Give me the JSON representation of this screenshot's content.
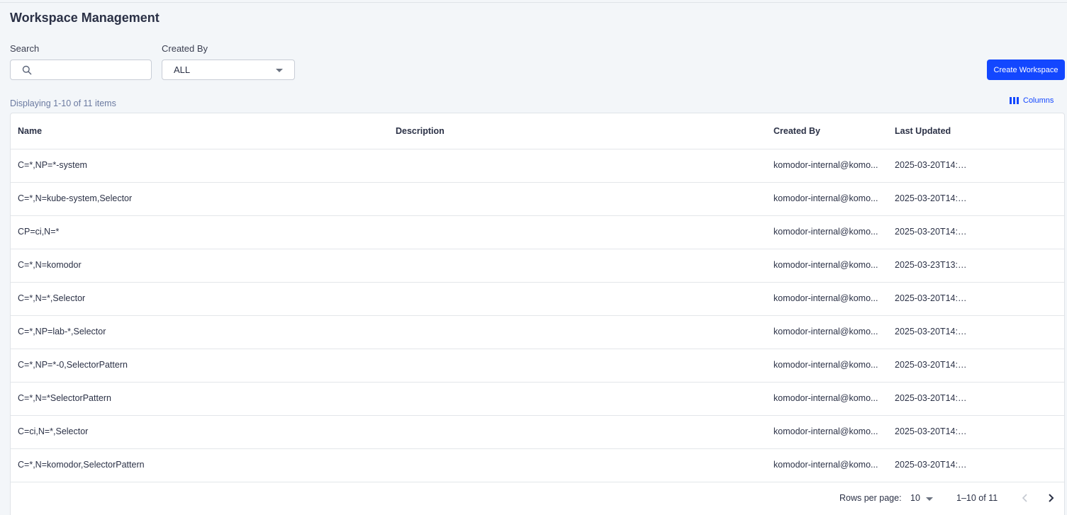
{
  "page": {
    "title": "Workspace Management"
  },
  "filters": {
    "search_label": "Search",
    "search_value": "",
    "created_by_label": "Created By",
    "created_by_value": "ALL"
  },
  "actions": {
    "create_label": "Create Workspace",
    "columns_label": "Columns"
  },
  "summary": {
    "displaying": "Displaying 1-10 of 11 items"
  },
  "table": {
    "headers": {
      "name": "Name",
      "description": "Description",
      "created_by": "Created By",
      "last_updated": "Last Updated"
    },
    "rows": [
      {
        "name": "C=*,NP=*-system",
        "description": "",
        "created_by": "komodor-internal@komo...",
        "last_updated": "2025-03-20T14:1..."
      },
      {
        "name": "C=*,N=kube-system,Selector",
        "description": "",
        "created_by": "komodor-internal@komo...",
        "last_updated": "2025-03-20T14:1..."
      },
      {
        "name": "CP=ci,N=*",
        "description": "",
        "created_by": "komodor-internal@komo...",
        "last_updated": "2025-03-20T14:1..."
      },
      {
        "name": "C=*,N=komodor",
        "description": "",
        "created_by": "komodor-internal@komo...",
        "last_updated": "2025-03-23T13:5..."
      },
      {
        "name": "C=*,N=*,Selector",
        "description": "",
        "created_by": "komodor-internal@komo...",
        "last_updated": "2025-03-20T14:1..."
      },
      {
        "name": "C=*,NP=lab-*,Selector",
        "description": "",
        "created_by": "komodor-internal@komo...",
        "last_updated": "2025-03-20T14:1..."
      },
      {
        "name": "C=*,NP=*-0,SelectorPattern",
        "description": "",
        "created_by": "komodor-internal@komo...",
        "last_updated": "2025-03-20T14:1..."
      },
      {
        "name": "C=*,N=*SelectorPattern",
        "description": "",
        "created_by": "komodor-internal@komo...",
        "last_updated": "2025-03-20T14:1..."
      },
      {
        "name": "C=ci,N=*,Selector",
        "description": "",
        "created_by": "komodor-internal@komo...",
        "last_updated": "2025-03-20T14:2..."
      },
      {
        "name": "C=*,N=komodor,SelectorPattern",
        "description": "",
        "created_by": "komodor-internal@komo...",
        "last_updated": "2025-03-20T14:2..."
      }
    ]
  },
  "pagination": {
    "rows_per_page_label": "Rows per page:",
    "rows_per_page_value": "10",
    "range": "1–10 of 11"
  },
  "icons": {
    "search": "search-icon",
    "dropdown": "chevron-down-icon",
    "columns": "columns-icon",
    "prev": "chevron-left-icon",
    "next": "chevron-right-icon"
  },
  "colors": {
    "accent": "#1347ff",
    "background": "#f3f6f9"
  }
}
